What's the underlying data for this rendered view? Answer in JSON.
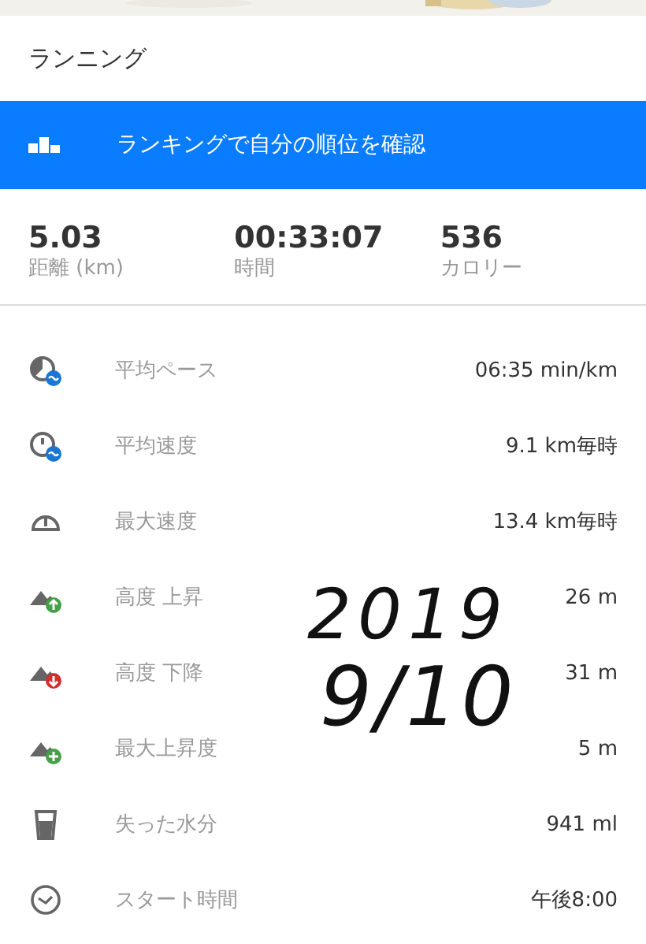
{
  "header": {
    "title": "ランニング"
  },
  "ranking_banner": {
    "label": "ランキングで自分の順位を確認"
  },
  "summary": [
    {
      "value": "5.03",
      "label": "距離 (km)"
    },
    {
      "value": "00:33:07",
      "label": "時間"
    },
    {
      "value": "536",
      "label": "カロリー"
    }
  ],
  "details": [
    {
      "kind": "pace",
      "label": "平均ペース",
      "value": "06:35 min/km"
    },
    {
      "kind": "speed",
      "label": "平均速度",
      "value": "9.1 km毎時"
    },
    {
      "kind": "max-speed",
      "label": "最大速度",
      "value": "13.4 km毎時"
    },
    {
      "kind": "ascent",
      "label": "高度 上昇",
      "value": "26 m"
    },
    {
      "kind": "descent",
      "label": "高度 下降",
      "value": "31 m"
    },
    {
      "kind": "max-ascent",
      "label": "最大上昇度",
      "value": "5 m"
    },
    {
      "kind": "water",
      "label": "失った水分",
      "value": "941 ml"
    },
    {
      "kind": "clock",
      "label": "スタート時間",
      "value": "午後8:00"
    }
  ],
  "handwriting": [
    "2019",
    "9/10"
  ]
}
